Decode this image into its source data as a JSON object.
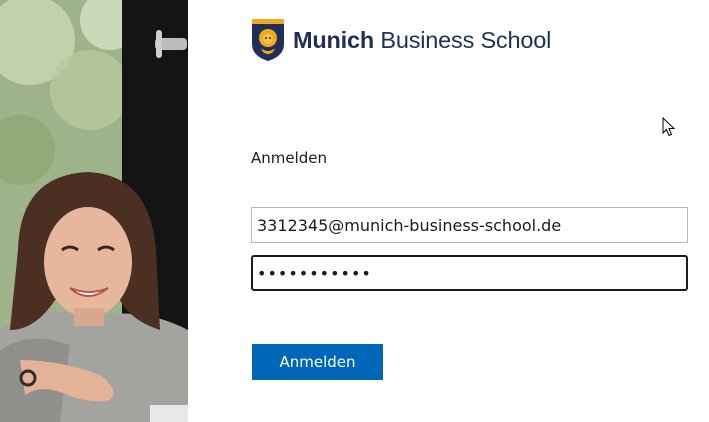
{
  "brand": {
    "name_bold": "Munich",
    "name_rest": " Business School",
    "shield_icon": "lion-shield-icon",
    "primary_color": "#1f2f5a",
    "shield_color": "#f2a81d"
  },
  "signin": {
    "heading": "Anmelden",
    "email_value": "3312345@munich-business-school.de",
    "password_value": "•••••••••••",
    "submit_label": "Anmelden",
    "accent_color": "#0067b8"
  },
  "decor": {
    "photo": "smiling-woman-photo",
    "cursor": "mouse-pointer-icon"
  }
}
